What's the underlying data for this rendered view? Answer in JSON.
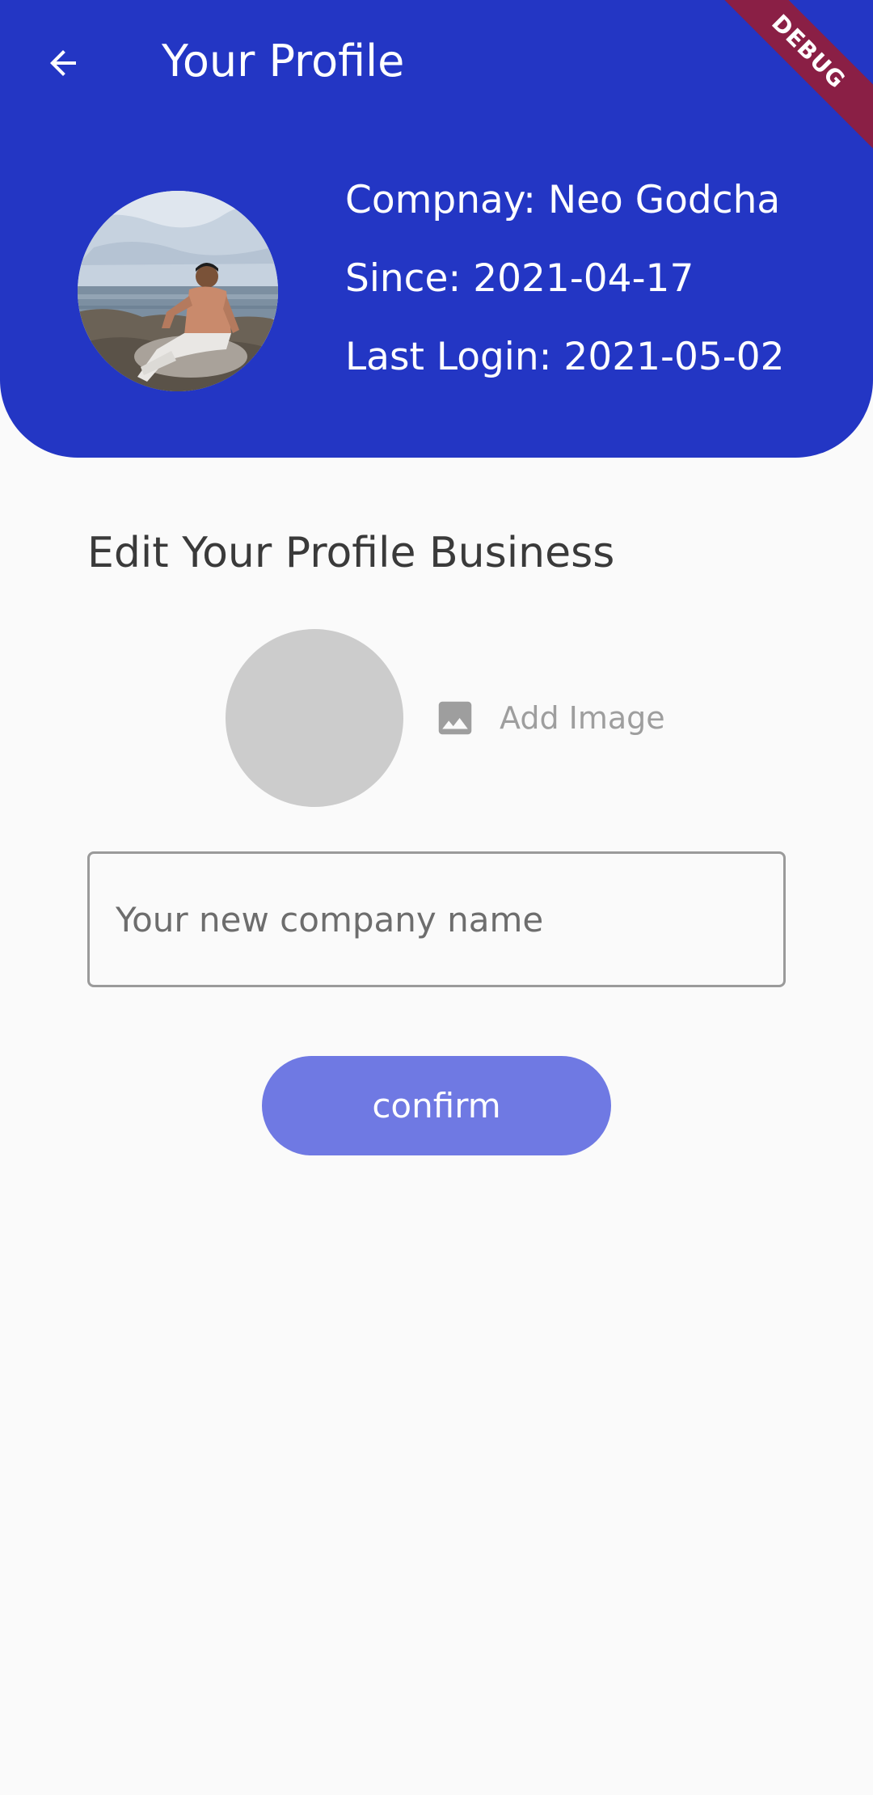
{
  "app_bar": {
    "title": "Your Profile",
    "back_icon": "arrow-back-icon"
  },
  "profile": {
    "company": "Compnay: Neo Godcha",
    "since": "Since: 2021-04-17",
    "last_login": "Last Login: 2021-05-02",
    "avatar": "profile-photo"
  },
  "edit": {
    "title": "Edit Your Profile Business",
    "add_image_label": "Add Image",
    "add_image_icon": "image-icon",
    "company_placeholder": "Your new company name",
    "company_value": "",
    "confirm_label": "confirm"
  },
  "debug_banner": "DEBUG",
  "colors": {
    "primary": "#2336c4",
    "confirm_button": "#6f79e3",
    "placeholder_circle": "#cccccc",
    "debug_banner": "#8a1f45",
    "background": "#fafafa"
  }
}
